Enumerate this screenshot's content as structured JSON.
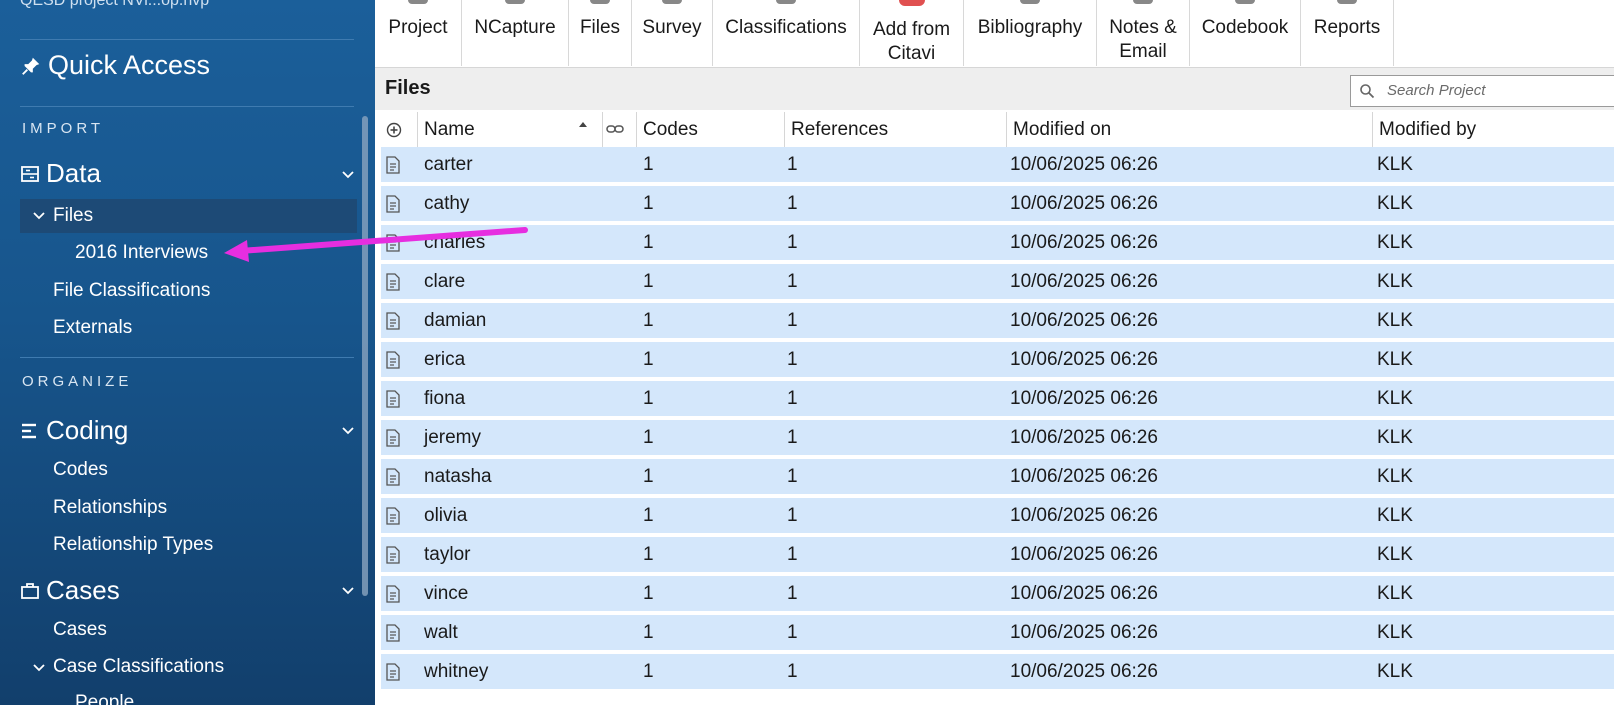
{
  "sidebar": {
    "project_name": "QESD project NVi...op.nvp",
    "quick_access": "Quick Access",
    "sections": {
      "import": "IMPORT",
      "organize": "ORGANIZE"
    },
    "data_group": "Data",
    "files_item": "Files",
    "interviews_item": "2016 Interviews",
    "file_classifications": "File Classifications",
    "externals": "Externals",
    "coding_group": "Coding",
    "codes": "Codes",
    "relationships": "Relationships",
    "relationship_types": "Relationship Types",
    "cases_group": "Cases",
    "cases": "Cases",
    "case_classifications": "Case Classifications",
    "people": "People"
  },
  "toolbar": {
    "project": "Project",
    "ncapture": "NCapture",
    "files": "Files",
    "survey": "Survey",
    "classifications": "Classifications",
    "add_from_citavi_1": "Add from",
    "add_from_citavi_2": "Citavi",
    "bibliography": "Bibliography",
    "notes_1": "Notes &",
    "notes_2": "Email",
    "codebook": "Codebook",
    "reports": "Reports"
  },
  "files_panel": {
    "title": "Files",
    "search_placeholder": "Search Project"
  },
  "table": {
    "columns": {
      "name": "Name",
      "codes": "Codes",
      "references": "References",
      "modified_on": "Modified on",
      "modified_by": "Modified by"
    },
    "rows": [
      {
        "name": "carter",
        "codes": "1",
        "references": "1",
        "modified_on": "10/06/2025 06:26",
        "modified_by": "KLK"
      },
      {
        "name": "cathy",
        "codes": "1",
        "references": "1",
        "modified_on": "10/06/2025 06:26",
        "modified_by": "KLK"
      },
      {
        "name": "charles",
        "codes": "1",
        "references": "1",
        "modified_on": "10/06/2025 06:26",
        "modified_by": "KLK"
      },
      {
        "name": "clare",
        "codes": "1",
        "references": "1",
        "modified_on": "10/06/2025 06:26",
        "modified_by": "KLK"
      },
      {
        "name": "damian",
        "codes": "1",
        "references": "1",
        "modified_on": "10/06/2025 06:26",
        "modified_by": "KLK"
      },
      {
        "name": "erica",
        "codes": "1",
        "references": "1",
        "modified_on": "10/06/2025 06:26",
        "modified_by": "KLK"
      },
      {
        "name": "fiona",
        "codes": "1",
        "references": "1",
        "modified_on": "10/06/2025 06:26",
        "modified_by": "KLK"
      },
      {
        "name": "jeremy",
        "codes": "1",
        "references": "1",
        "modified_on": "10/06/2025 06:26",
        "modified_by": "KLK"
      },
      {
        "name": "natasha",
        "codes": "1",
        "references": "1",
        "modified_on": "10/06/2025 06:26",
        "modified_by": "KLK"
      },
      {
        "name": "olivia",
        "codes": "1",
        "references": "1",
        "modified_on": "10/06/2025 06:26",
        "modified_by": "KLK"
      },
      {
        "name": "taylor",
        "codes": "1",
        "references": "1",
        "modified_on": "10/06/2025 06:26",
        "modified_by": "KLK"
      },
      {
        "name": "vince",
        "codes": "1",
        "references": "1",
        "modified_on": "10/06/2025 06:26",
        "modified_by": "KLK"
      },
      {
        "name": "walt",
        "codes": "1",
        "references": "1",
        "modified_on": "10/06/2025 06:26",
        "modified_by": "KLK"
      },
      {
        "name": "whitney",
        "codes": "1",
        "references": "1",
        "modified_on": "10/06/2025 06:26",
        "modified_by": "KLK"
      }
    ]
  },
  "colors": {
    "sidebar_bg": "#17558c",
    "row_selected": "#d4e7fb",
    "annotation_arrow": "#e62ee0"
  },
  "icons": {
    "pin": "pin-icon",
    "data": "data-icon",
    "coding": "coding-icon",
    "cases": "cases-icon",
    "file": "document-icon",
    "search": "search-icon",
    "add_column": "add-column-icon",
    "link": "link-icon"
  }
}
